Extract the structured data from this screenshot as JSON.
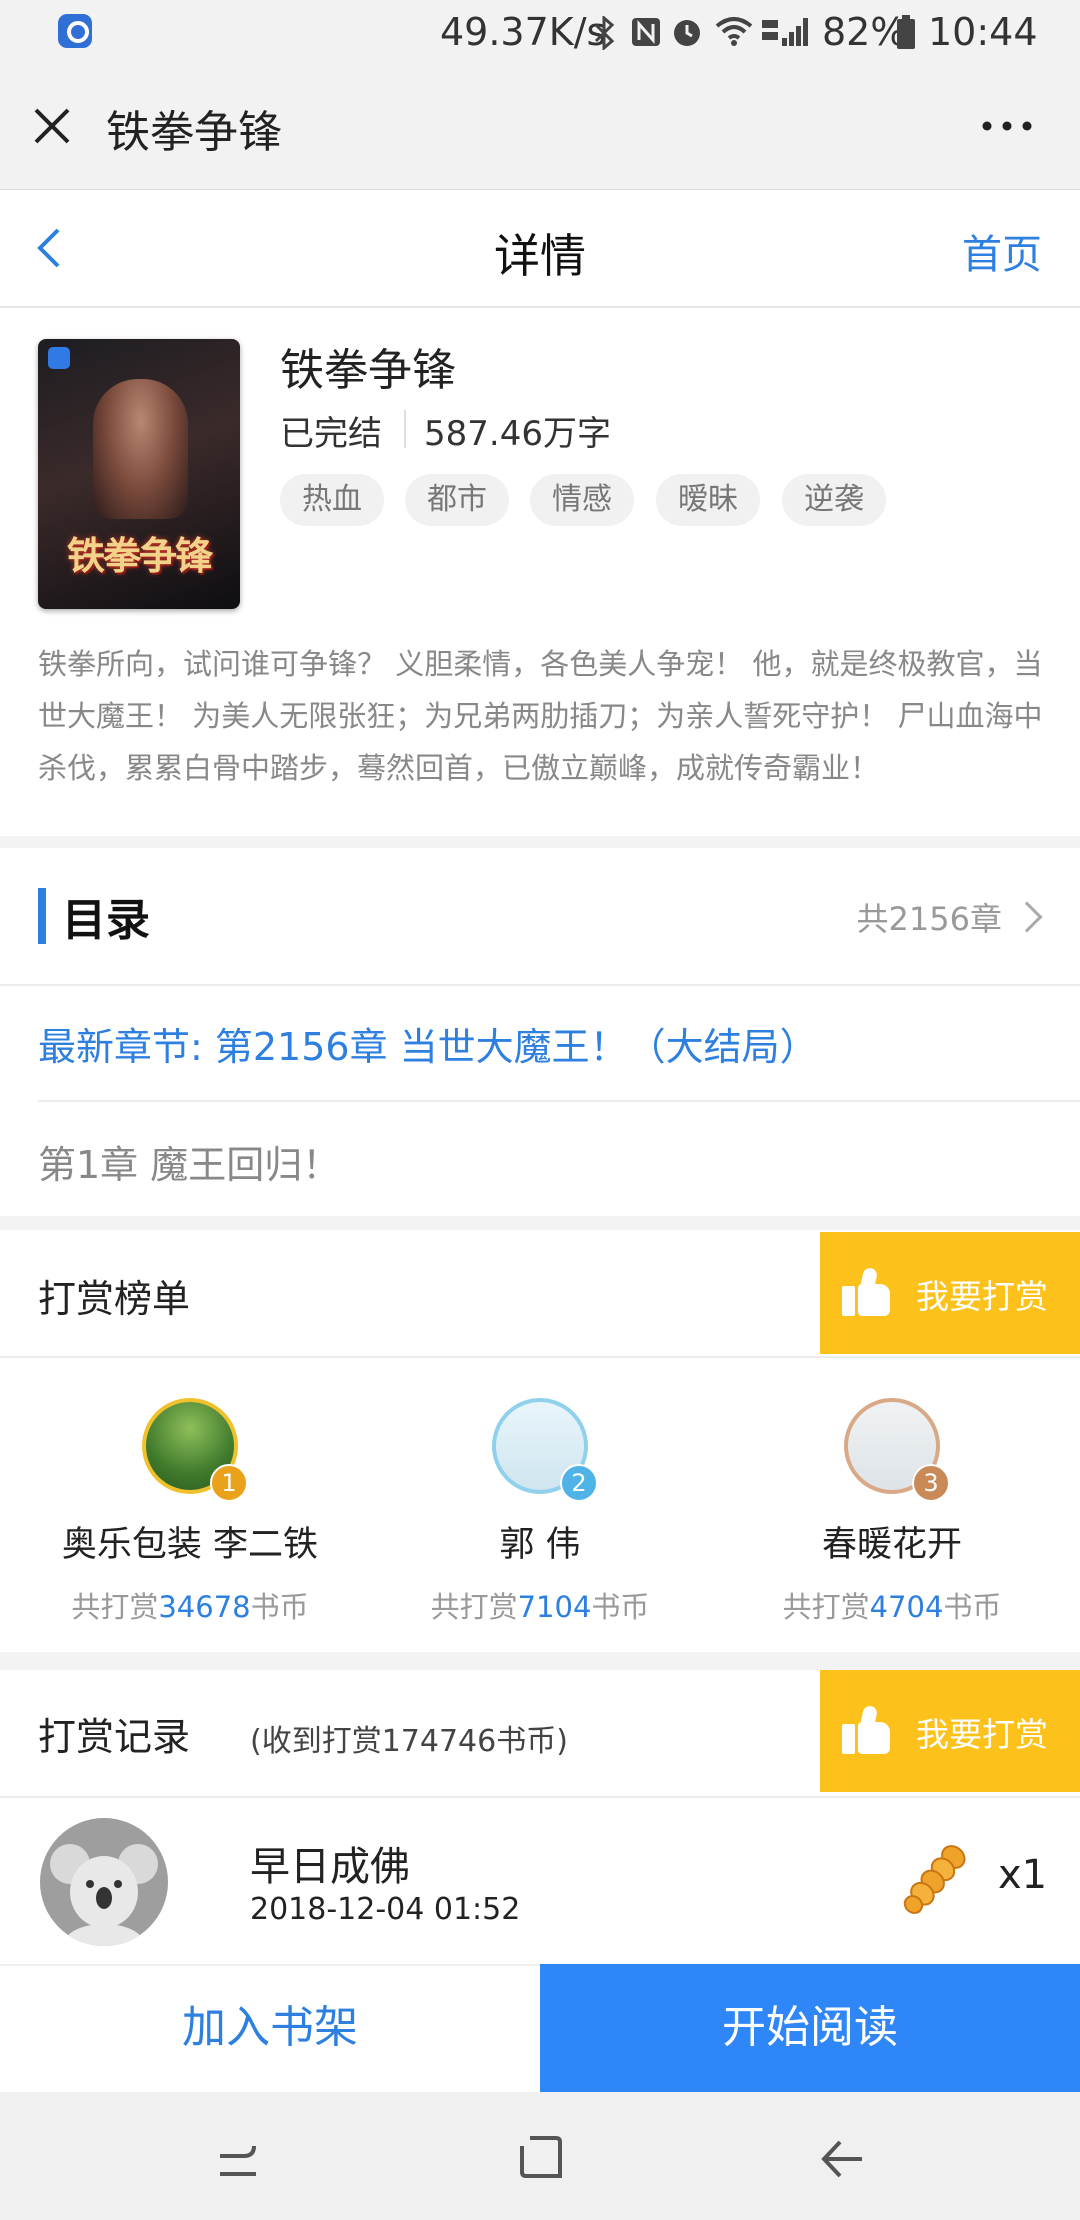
{
  "status_bar": {
    "speed": "49.37K/s",
    "battery": "82%",
    "time": "10:44",
    "icons": [
      "app-notification-icon",
      "bluetooth-icon",
      "nfc-icon",
      "alarm-icon",
      "wifi-icon",
      "signal-icon",
      "battery-icon"
    ]
  },
  "webview_bar": {
    "title": "铁拳争锋",
    "close_icon": "close-icon",
    "more_icon": "more-icon"
  },
  "nav": {
    "title": "详情",
    "home_label": "首页",
    "back_icon": "chevron-left-icon"
  },
  "book": {
    "cover_title": "铁拳争锋",
    "title": "铁拳争锋",
    "status": "已完结",
    "word_count": "587.46万字",
    "tags": [
      "热血",
      "都市",
      "情感",
      "暧昧",
      "逆袭"
    ],
    "description": "铁拳所向，试问谁可争锋？ 义胆柔情，各色美人争宠！ 他，就是终极教官，当世大魔王！ 为美人无限张狂；为兄弟两肋插刀；为亲人誓死守护！ 尸山血海中杀伐，累累白骨中踏步，蓦然回首，已傲立巅峰，成就传奇霸业！"
  },
  "catalog": {
    "title": "目录",
    "total": "共2156章",
    "latest": "最新章节: 第2156章 当世大魔王！（大结局）",
    "first": "第1章 魔王回归！"
  },
  "reward_rank": {
    "title": "打赏榜单",
    "button_label": "我要打赏",
    "entries": [
      {
        "rank": "1",
        "name": "奥乐包装 李二铁",
        "prefix": "共打赏",
        "amount": "34678",
        "unit": "书币",
        "medal_color": "#e9a21a"
      },
      {
        "rank": "2",
        "name": "郭 伟",
        "prefix": "共打赏",
        "amount": "7104",
        "unit": "书币",
        "medal_color": "#4fb3e8"
      },
      {
        "rank": "3",
        "name": "春暖花开",
        "prefix": "共打赏",
        "amount": "4704",
        "unit": "书币",
        "medal_color": "#c98a57"
      }
    ]
  },
  "reward_records": {
    "title": "打赏记录",
    "summary": "(收到打赏174746书币)",
    "button_label": "我要打赏",
    "items": [
      {
        "name": "早日成佛",
        "time": "2018-12-04 01:52",
        "gift_icon": "twisted-bread-icon",
        "count": "x1"
      }
    ]
  },
  "actions": {
    "add_shelf": "加入书架",
    "start_reading": "开始阅读"
  },
  "colors": {
    "accent_blue": "#2d7fe0",
    "reward_yellow": "#fcc21b",
    "read_button_blue": "#2f86f6"
  }
}
